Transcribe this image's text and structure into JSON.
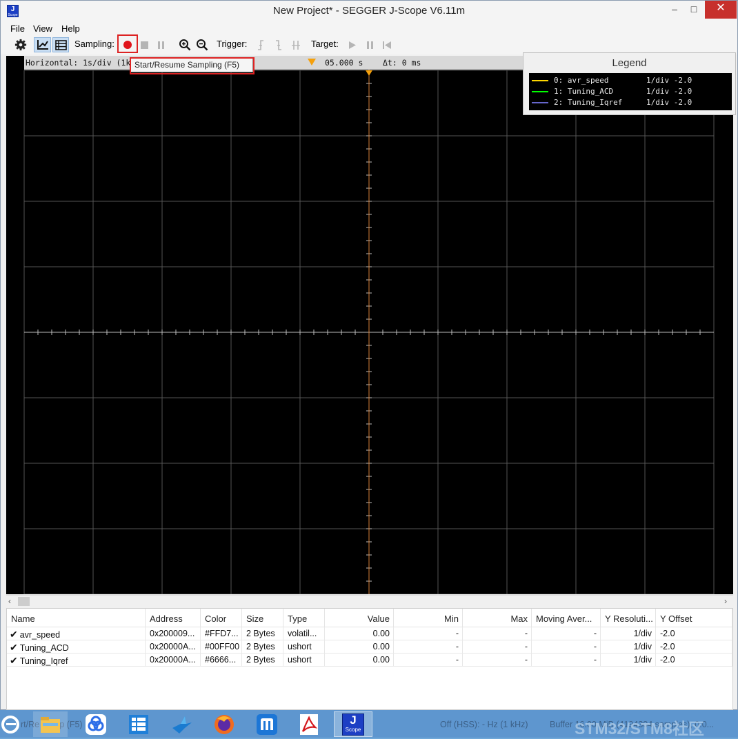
{
  "window": {
    "title": "New Project* - SEGGER J-Scope V6.11m",
    "app_icon_letter": "J",
    "app_icon_sub": "Scope"
  },
  "menu": [
    "File",
    "View",
    "Help"
  ],
  "toolbar": {
    "sampling_label": "Sampling:",
    "trigger_label": "Trigger:",
    "target_label": "Target:"
  },
  "plot": {
    "horizontal_label": "Horizontal: 1s/div (1k",
    "time_cursor": "05.000 s",
    "delta_t": "Δt: 0 ms",
    "tooltip": "Start/Resume Sampling (F5)"
  },
  "legend": {
    "title": "Legend",
    "items": [
      {
        "name": "0: avr_speed",
        "resolution": "1/div -2.0",
        "color": "#FFD700"
      },
      {
        "name": "1: Tuning_ACD",
        "resolution": "1/div -2.0",
        "color": "#00FF00"
      },
      {
        "name": "2: Tuning_Iqref",
        "resolution": "1/div -2.0",
        "color": "#6666CC"
      }
    ]
  },
  "table": {
    "columns": [
      "Name",
      "Address",
      "Color",
      "Size",
      "Type",
      "Value",
      "Min",
      "Max",
      "Moving Aver...",
      "Y Resoluti...",
      "Y Offset"
    ],
    "rows": [
      [
        "avr_speed",
        "0x200009...",
        "#FFD7...",
        "2 Bytes",
        "volatil...",
        "0.00",
        "-",
        "-",
        "-",
        "1/div",
        "-2.0"
      ],
      [
        "Tuning_ACD",
        "0x20000A...",
        "#00FF00",
        "2 Bytes",
        "ushort",
        "0.00",
        "-",
        "-",
        "-",
        "1/div",
        "-2.0"
      ],
      [
        "Tuning_Iqref",
        "0x20000A...",
        "#6666...",
        "2 Bytes",
        "ushort",
        "0.00",
        "-",
        "-",
        "-",
        "1/div",
        "-2.0"
      ]
    ]
  },
  "taskbar": {
    "status_left": "rt/Re     Samp    (F5)",
    "status_mid": "Off (HSS): - Hz (1 kHz)",
    "status_right": "Buffer 16.00 MiB (4194304 samples), 0.0...",
    "watermark": "STM32/STM8社区",
    "jscope_letter": "J",
    "jscope_sub": "Scope"
  }
}
